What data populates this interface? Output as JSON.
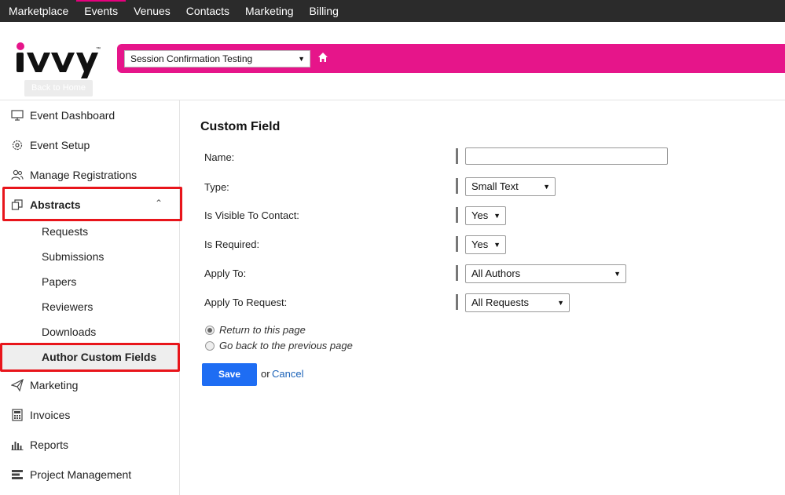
{
  "topnav": {
    "items": [
      "Marketplace",
      "Events",
      "Venues",
      "Contacts",
      "Marketing",
      "Billing"
    ],
    "active_index": 1
  },
  "header": {
    "logo_text": "iVvy",
    "back_home_label": "Back to Home",
    "event_select_value": "Session Confirmation Testing",
    "accent_color": "#e6158a"
  },
  "sidebar": {
    "items": [
      {
        "label": "Event Dashboard",
        "icon": "monitor-icon"
      },
      {
        "label": "Event Setup",
        "icon": "gear-icon"
      },
      {
        "label": "Manage Registrations",
        "icon": "users-icon"
      },
      {
        "label": "Abstracts",
        "icon": "abstracts-icon"
      },
      {
        "label": "Marketing",
        "icon": "send-icon"
      },
      {
        "label": "Invoices",
        "icon": "calculator-icon"
      },
      {
        "label": "Reports",
        "icon": "bar-chart-icon"
      },
      {
        "label": "Project Management",
        "icon": "tasks-icon"
      }
    ],
    "abstracts_sub": [
      "Requests",
      "Submissions",
      "Papers",
      "Reviewers",
      "Downloads",
      "Author Custom Fields"
    ],
    "highlight_color": "#e8151b"
  },
  "form": {
    "title": "Custom Field",
    "name_label": "Name:",
    "name_value": "",
    "type_label": "Type:",
    "type_value": "Small Text",
    "visible_label": "Is Visible To Contact:",
    "visible_value": "Yes",
    "required_label": "Is Required:",
    "required_value": "Yes",
    "apply_to_label": "Apply To:",
    "apply_to_value": "All Authors",
    "apply_request_label": "Apply To Request:",
    "apply_request_value": "All Requests",
    "radio_return": "Return to this page",
    "radio_back": "Go back to the previous page",
    "save_label": "Save",
    "or_text": "or",
    "cancel_label": "Cancel"
  }
}
